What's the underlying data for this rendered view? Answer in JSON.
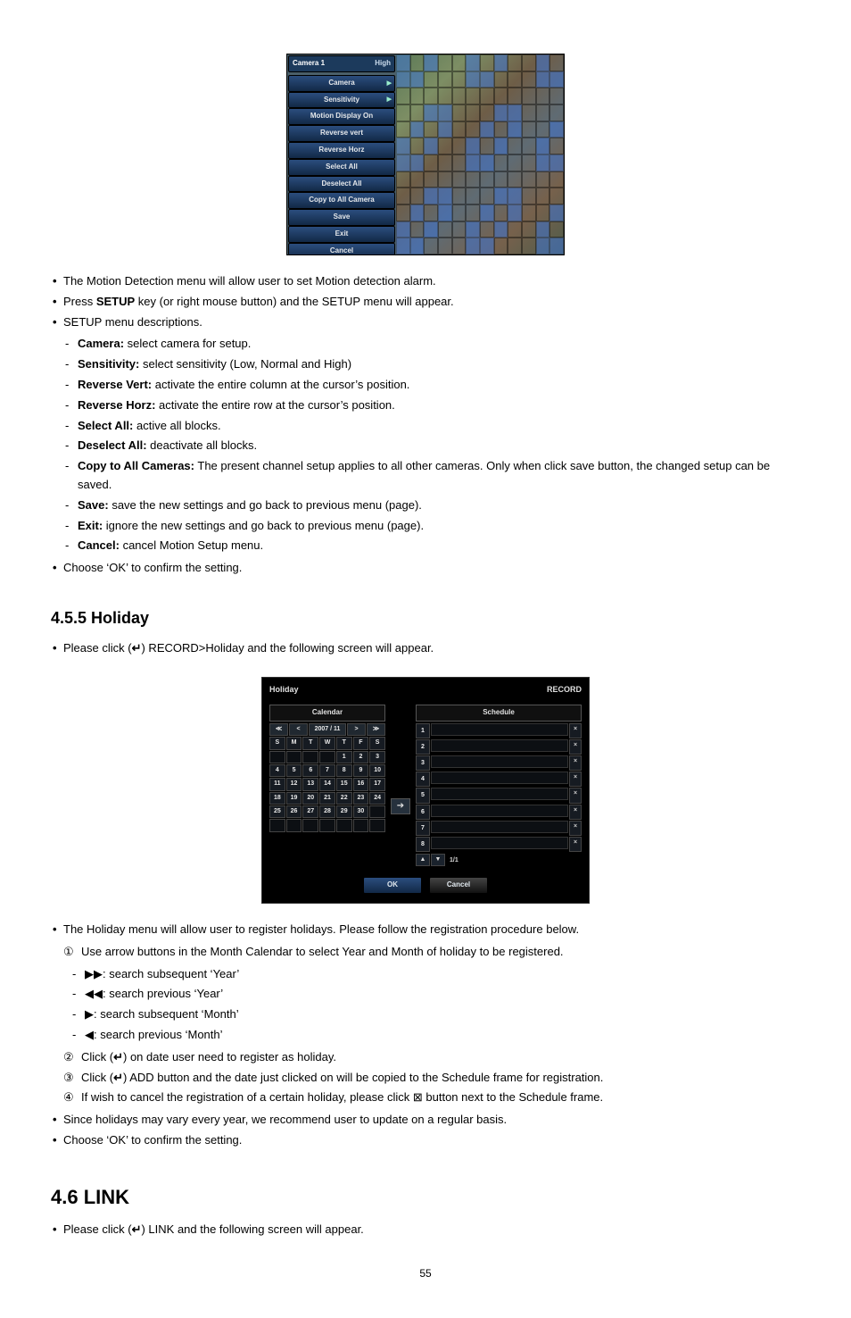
{
  "motion": {
    "menu_header": "Camera  1",
    "menu_header_value": "High",
    "items": [
      {
        "label": "Camera",
        "arrow": true
      },
      {
        "label": "Sensitivity",
        "arrow": true
      },
      {
        "label": "Motion Display On"
      },
      {
        "label": "Reverse vert"
      },
      {
        "label": "Reverse Horz"
      },
      {
        "label": "Select All"
      },
      {
        "label": "Deselect All"
      },
      {
        "label": "Copy to All Camera"
      },
      {
        "label": "Save"
      },
      {
        "label": "Exit"
      },
      {
        "label": "Cancel"
      }
    ]
  },
  "bullets_motion": {
    "b1": "The Motion Detection menu will allow user to set Motion detection alarm.",
    "b2_pre": "Press ",
    "b2_bold": "SETUP",
    "b2_post": " key (or right mouse button) and the SETUP menu will appear.",
    "b3": "SETUP menu descriptions.",
    "b4": "Choose ‘OK’ to confirm the setting."
  },
  "setup_desc": [
    {
      "label": "Camera:",
      "text": " select camera for setup."
    },
    {
      "label": "Sensitivity:",
      "text": " select sensitivity (Low, Normal and High)"
    },
    {
      "label": "Reverse Vert:",
      "text": " activate the entire column at the cursor’s position."
    },
    {
      "label": "Reverse Horz:",
      "text": " activate the entire row at the cursor’s position."
    },
    {
      "label": "Select All:",
      "text": " active all blocks."
    },
    {
      "label": "Deselect All:",
      "text": " deactivate all blocks."
    },
    {
      "label": "Copy to All Cameras:",
      "text": " The present channel setup applies to all other cameras. Only when click save button, the changed setup can be saved."
    },
    {
      "label": "Save:",
      "text": " save the new settings and go back to previous menu (page)."
    },
    {
      "label": "Exit:",
      "text": " ignore the new settings and go back to previous menu (page)."
    },
    {
      "label": "Cancel:",
      "text": " cancel Motion Setup menu."
    }
  ],
  "sec_holiday": "4.5.5   Holiday",
  "holiday_intro_pre": "Please click (",
  "holiday_intro_post": ") RECORD>Holiday and the following screen will appear.",
  "holiday_dlg": {
    "title_left": "Holiday",
    "title_right": "RECORD",
    "calendar_label": "Calendar",
    "cal_period": "2007 / 11",
    "dow": [
      "S",
      "M",
      "T",
      "W",
      "T",
      "F",
      "S"
    ],
    "days": [
      [
        "",
        "",
        "",
        "",
        "1",
        "2",
        "3"
      ],
      [
        "4",
        "5",
        "6",
        "7",
        "8",
        "9",
        "10"
      ],
      [
        "11",
        "12",
        "13",
        "14",
        "15",
        "16",
        "17"
      ],
      [
        "18",
        "19",
        "20",
        "21",
        "22",
        "23",
        "24"
      ],
      [
        "25",
        "26",
        "27",
        "28",
        "29",
        "30",
        ""
      ],
      [
        "",
        "",
        "",
        "",
        "",
        "",
        ""
      ]
    ],
    "schedule_label": "Schedule",
    "rows": [
      "1",
      "2",
      "3",
      "4",
      "5",
      "6",
      "7",
      "8"
    ],
    "pager": "1/1",
    "ok": "OK",
    "cancel": "Cancel"
  },
  "bullets_holiday": {
    "intro": "The Holiday menu will allow user to register holidays. Please follow the registration procedure below.",
    "step1": "Use arrow buttons in the Month Calendar to select Year and Month of holiday to be registered.",
    "arrows": [
      {
        "sym": "▶▶",
        "text": ": search subsequent ‘Year’"
      },
      {
        "sym": "◀◀",
        "text": ": search previous ‘Year’"
      },
      {
        "sym": "▶",
        "text": ": search subsequent ‘Month’"
      },
      {
        "sym": "◀",
        "text": ": search previous ‘Month’"
      }
    ],
    "step2_pre": "Click (",
    "step2_post": ") on date user need to register as holiday.",
    "step3_pre": "Click (",
    "step3_post": ") ADD button and the date just clicked on will be copied to the Schedule frame for registration.",
    "step4": "If wish to cancel the registration of a certain holiday, please click ⊠ button next to the Schedule frame.",
    "note": "Since holidays may vary every year, we recommend user to update on a regular basis.",
    "confirm": "Choose ‘OK’ to confirm the setting."
  },
  "circled": [
    "①",
    "②",
    "③",
    "④"
  ],
  "sec_link": "4.6  LINK",
  "link_intro_pre": "Please click (",
  "link_intro_post": ") LINK and the following screen will appear.",
  "page_num": "55",
  "glyph_enter": "↵"
}
